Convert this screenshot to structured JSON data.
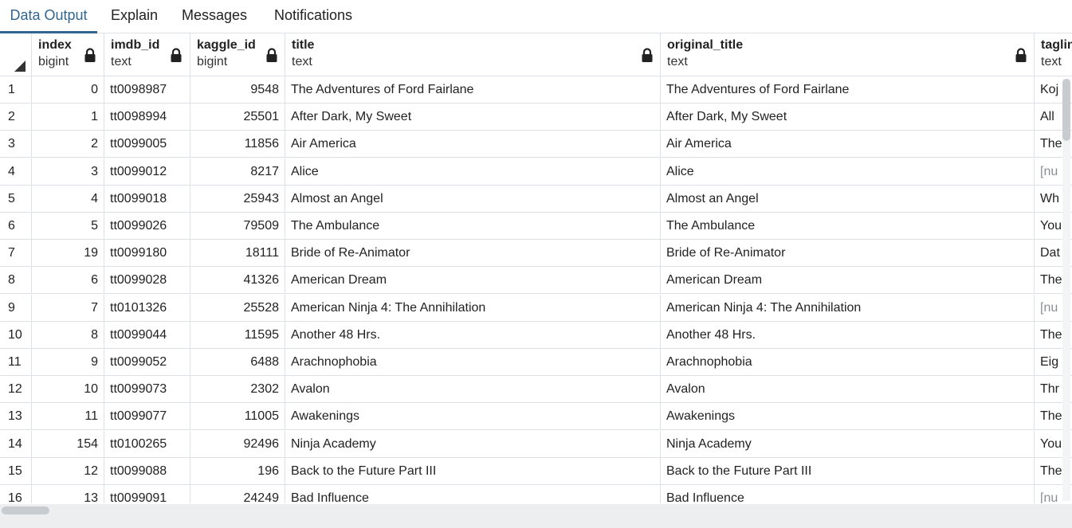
{
  "tabs": [
    {
      "label": "Data Output",
      "active": true
    },
    {
      "label": "Explain",
      "active": false
    },
    {
      "label": "Messages",
      "active": false
    },
    {
      "label": "Notifications",
      "active": false
    }
  ],
  "columns": [
    {
      "name": "index",
      "type": "bigint",
      "locked": true
    },
    {
      "name": "imdb_id",
      "type": "text",
      "locked": true
    },
    {
      "name": "kaggle_id",
      "type": "bigint",
      "locked": true
    },
    {
      "name": "title",
      "type": "text",
      "locked": true
    },
    {
      "name": "original_title",
      "type": "text",
      "locked": true
    },
    {
      "name": "taglin",
      "type": "text",
      "locked": false
    }
  ],
  "rows": [
    {
      "rownum": "1",
      "index": "0",
      "imdb_id": "tt0098987",
      "kaggle_id": "9548",
      "title": "The Adventures of Ford Fairlane",
      "original_title": "The Adventures of Ford Fairlane",
      "tagline": "Koj"
    },
    {
      "rownum": "2",
      "index": "1",
      "imdb_id": "tt0098994",
      "kaggle_id": "25501",
      "title": "After Dark, My Sweet",
      "original_title": "After Dark, My Sweet",
      "tagline": "All "
    },
    {
      "rownum": "3",
      "index": "2",
      "imdb_id": "tt0099005",
      "kaggle_id": "11856",
      "title": "Air America",
      "original_title": "Air America",
      "tagline": "The"
    },
    {
      "rownum": "4",
      "index": "3",
      "imdb_id": "tt0099012",
      "kaggle_id": "8217",
      "title": "Alice",
      "original_title": "Alice",
      "tagline": "[nu"
    },
    {
      "rownum": "5",
      "index": "4",
      "imdb_id": "tt0099018",
      "kaggle_id": "25943",
      "title": "Almost an Angel",
      "original_title": "Almost an Angel",
      "tagline": "Wh"
    },
    {
      "rownum": "6",
      "index": "5",
      "imdb_id": "tt0099026",
      "kaggle_id": "79509",
      "title": "The Ambulance",
      "original_title": "The Ambulance",
      "tagline": "You"
    },
    {
      "rownum": "7",
      "index": "19",
      "imdb_id": "tt0099180",
      "kaggle_id": "18111",
      "title": "Bride of Re-Animator",
      "original_title": "Bride of Re-Animator",
      "tagline": "Dat"
    },
    {
      "rownum": "8",
      "index": "6",
      "imdb_id": "tt0099028",
      "kaggle_id": "41326",
      "title": "American Dream",
      "original_title": "American Dream",
      "tagline": "The"
    },
    {
      "rownum": "9",
      "index": "7",
      "imdb_id": "tt0101326",
      "kaggle_id": "25528",
      "title": "American Ninja 4: The Annihilation",
      "original_title": "American Ninja 4: The Annihilation",
      "tagline": "[nu"
    },
    {
      "rownum": "10",
      "index": "8",
      "imdb_id": "tt0099044",
      "kaggle_id": "11595",
      "title": "Another 48 Hrs.",
      "original_title": "Another 48 Hrs.",
      "tagline": "The"
    },
    {
      "rownum": "11",
      "index": "9",
      "imdb_id": "tt0099052",
      "kaggle_id": "6488",
      "title": "Arachnophobia",
      "original_title": "Arachnophobia",
      "tagline": "Eig"
    },
    {
      "rownum": "12",
      "index": "10",
      "imdb_id": "tt0099073",
      "kaggle_id": "2302",
      "title": "Avalon",
      "original_title": "Avalon",
      "tagline": "Thr"
    },
    {
      "rownum": "13",
      "index": "11",
      "imdb_id": "tt0099077",
      "kaggle_id": "11005",
      "title": "Awakenings",
      "original_title": "Awakenings",
      "tagline": "The"
    },
    {
      "rownum": "14",
      "index": "154",
      "imdb_id": "tt0100265",
      "kaggle_id": "92496",
      "title": "Ninja Academy",
      "original_title": "Ninja Academy",
      "tagline": "You"
    },
    {
      "rownum": "15",
      "index": "12",
      "imdb_id": "tt0099088",
      "kaggle_id": "196",
      "title": "Back to the Future Part III",
      "original_title": "Back to the Future Part III",
      "tagline": "The"
    },
    {
      "rownum": "16",
      "index": "13",
      "imdb_id": "tt0099091",
      "kaggle_id": "24249",
      "title": "Bad Influence",
      "original_title": "Bad Influence",
      "tagline": "[nu"
    }
  ]
}
